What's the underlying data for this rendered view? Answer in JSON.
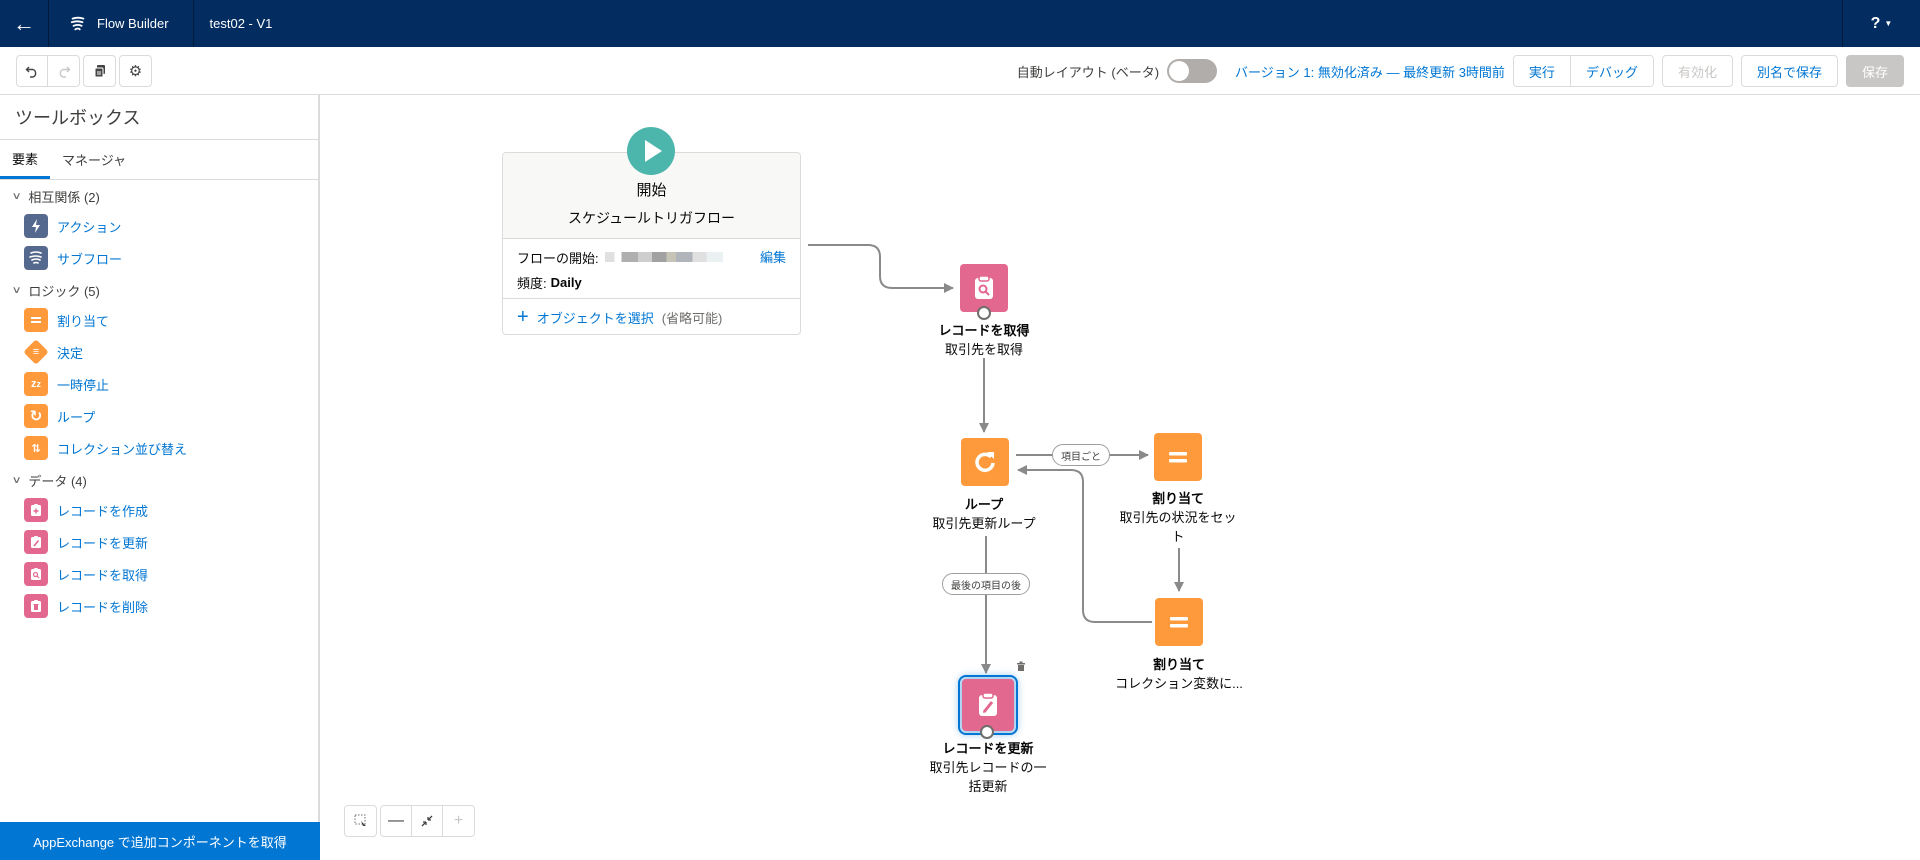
{
  "header": {
    "back_icon": "arrow-left-icon",
    "app_name": "Flow Builder",
    "flow_title": "test02 - V1",
    "help_label": "?"
  },
  "toolbar": {
    "undo_icon": "undo-icon",
    "redo_icon": "redo-icon",
    "copy_icon": "copy-icon",
    "settings_icon": "gear-icon",
    "auto_layout_label": "自動レイアウト (ベータ)",
    "auto_layout_on": false,
    "version_status": "バージョン 1: 無効化済み — 最終更新 3時間前",
    "run_label": "実行",
    "debug_label": "デバッグ",
    "activate_label": "有効化",
    "save_as_label": "別名で保存",
    "save_label": "保存"
  },
  "sidebar": {
    "title": "ツールボックス",
    "tabs": [
      {
        "label": "要素",
        "active": true
      },
      {
        "label": "マネージャ",
        "active": false
      }
    ],
    "sections": [
      {
        "label": "相互関係 (2)",
        "items": [
          {
            "label": "アクション",
            "icon": "lightning-icon",
            "color": "#54698d"
          },
          {
            "label": "サブフロー",
            "icon": "subflow-icon",
            "color": "#54698d"
          }
        ]
      },
      {
        "label": "ロジック (5)",
        "items": [
          {
            "label": "割り当て",
            "icon": "assignment-icon",
            "color": "#ff9a3c"
          },
          {
            "label": "決定",
            "icon": "decision-icon",
            "color": "#ff9a3c"
          },
          {
            "label": "一時停止",
            "icon": "pause-icon",
            "color": "#ff9a3c"
          },
          {
            "label": "ループ",
            "icon": "loop-icon",
            "color": "#ff9a3c"
          },
          {
            "label": "コレクション並び替え",
            "icon": "sort-icon",
            "color": "#ff9a3c"
          }
        ]
      },
      {
        "label": "データ (4)",
        "items": [
          {
            "label": "レコードを作成",
            "icon": "record-create-icon",
            "color": "#e3688f"
          },
          {
            "label": "レコードを更新",
            "icon": "record-update-icon",
            "color": "#e3688f"
          },
          {
            "label": "レコードを取得",
            "icon": "record-lookup-icon",
            "color": "#e3688f"
          },
          {
            "label": "レコードを削除",
            "icon": "record-delete-icon",
            "color": "#e3688f"
          }
        ]
      }
    ],
    "appexchange_label": "AppExchange で追加コンポーネントを取得"
  },
  "canvas": {
    "start": {
      "title": "開始",
      "subtitle": "スケジュールトリガフロー",
      "start_label": "フローの開始:",
      "edit_label": "編集",
      "frequency_label": "頻度:",
      "frequency_value": "Daily",
      "select_object_label": "オブジェクトを選択",
      "optional_label": "(省略可能)"
    },
    "nodes": [
      {
        "id": "get-records",
        "type": "レコードを取得",
        "label": "取引先を取得",
        "color": "#e3688f"
      },
      {
        "id": "loop",
        "type": "ループ",
        "label": "取引先更新ループ",
        "color": "#ff9a3c"
      },
      {
        "id": "assign-1",
        "type": "割り当て",
        "label": "取引先の状況をセット",
        "color": "#ff9a3c"
      },
      {
        "id": "assign-2",
        "type": "割り当て",
        "label": "コレクション変数に...",
        "color": "#ff9a3c"
      },
      {
        "id": "update-records",
        "type": "レコードを更新",
        "label": "取引先レコードの一括更新",
        "color": "#e3688f",
        "selected": true
      }
    ],
    "connectors": {
      "for_each": "項目ごと",
      "after_last": "最後の項目の後"
    }
  },
  "zoom_controls": {
    "marquee_icon": "marquee-select-icon",
    "zoom_out_icon": "minus-icon",
    "fit_icon": "fit-to-screen-icon",
    "zoom_in_icon": "plus-icon"
  }
}
